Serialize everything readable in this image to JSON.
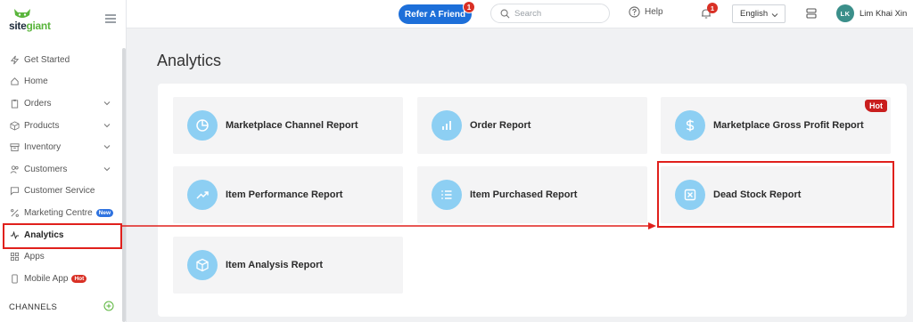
{
  "brand": {
    "logo_text_1": "site",
    "logo_text_2": "giant"
  },
  "sidebar": {
    "items": [
      {
        "label": "Get Started",
        "icon": "lightning-icon",
        "has_chevron": false
      },
      {
        "label": "Home",
        "icon": "home-icon",
        "has_chevron": false
      },
      {
        "label": "Orders",
        "icon": "clipboard-icon",
        "has_chevron": true
      },
      {
        "label": "Products",
        "icon": "box-icon",
        "has_chevron": true
      },
      {
        "label": "Inventory",
        "icon": "archive-icon",
        "has_chevron": true
      },
      {
        "label": "Customers",
        "icon": "users-icon",
        "has_chevron": true
      },
      {
        "label": "Customer Service",
        "icon": "chat-icon",
        "has_chevron": false
      },
      {
        "label": "Marketing Centre",
        "icon": "percent-icon",
        "badge": "New"
      },
      {
        "label": "Analytics",
        "icon": "activity-icon",
        "active": true
      },
      {
        "label": "Apps",
        "icon": "apps-grid-icon"
      },
      {
        "label": "Mobile App",
        "icon": "phone-icon",
        "badge": "Hot"
      }
    ],
    "section_label": "CHANNELS"
  },
  "topbar": {
    "refer_label": "Refer A Friend",
    "refer_badge": "1",
    "search_placeholder": "Search",
    "help_label": "Help",
    "notification_count": "1",
    "language": "English",
    "user_initials": "LK",
    "user_name": "Lim Khai Xin"
  },
  "main": {
    "title": "Analytics",
    "reports": [
      {
        "label": "Marketplace Channel Report",
        "icon": "pie-chart-icon"
      },
      {
        "label": "Order Report",
        "icon": "bar-chart-icon"
      },
      {
        "label": "Marketplace Gross Profit Report",
        "icon": "dollar-icon",
        "tag": "Hot"
      },
      {
        "label": "Item Performance Report",
        "icon": "trending-up-icon"
      },
      {
        "label": "Item Purchased Report",
        "icon": "list-icon"
      },
      {
        "label": "Dead Stock Report",
        "icon": "x-square-icon"
      },
      {
        "label": "Item Analysis Report",
        "icon": "cube-icon"
      }
    ]
  },
  "colors": {
    "accent_blue": "#1d6fd9",
    "badge_red": "#d93025",
    "icon_circle": "#8dcff3",
    "highlight_red": "#e0201c"
  }
}
